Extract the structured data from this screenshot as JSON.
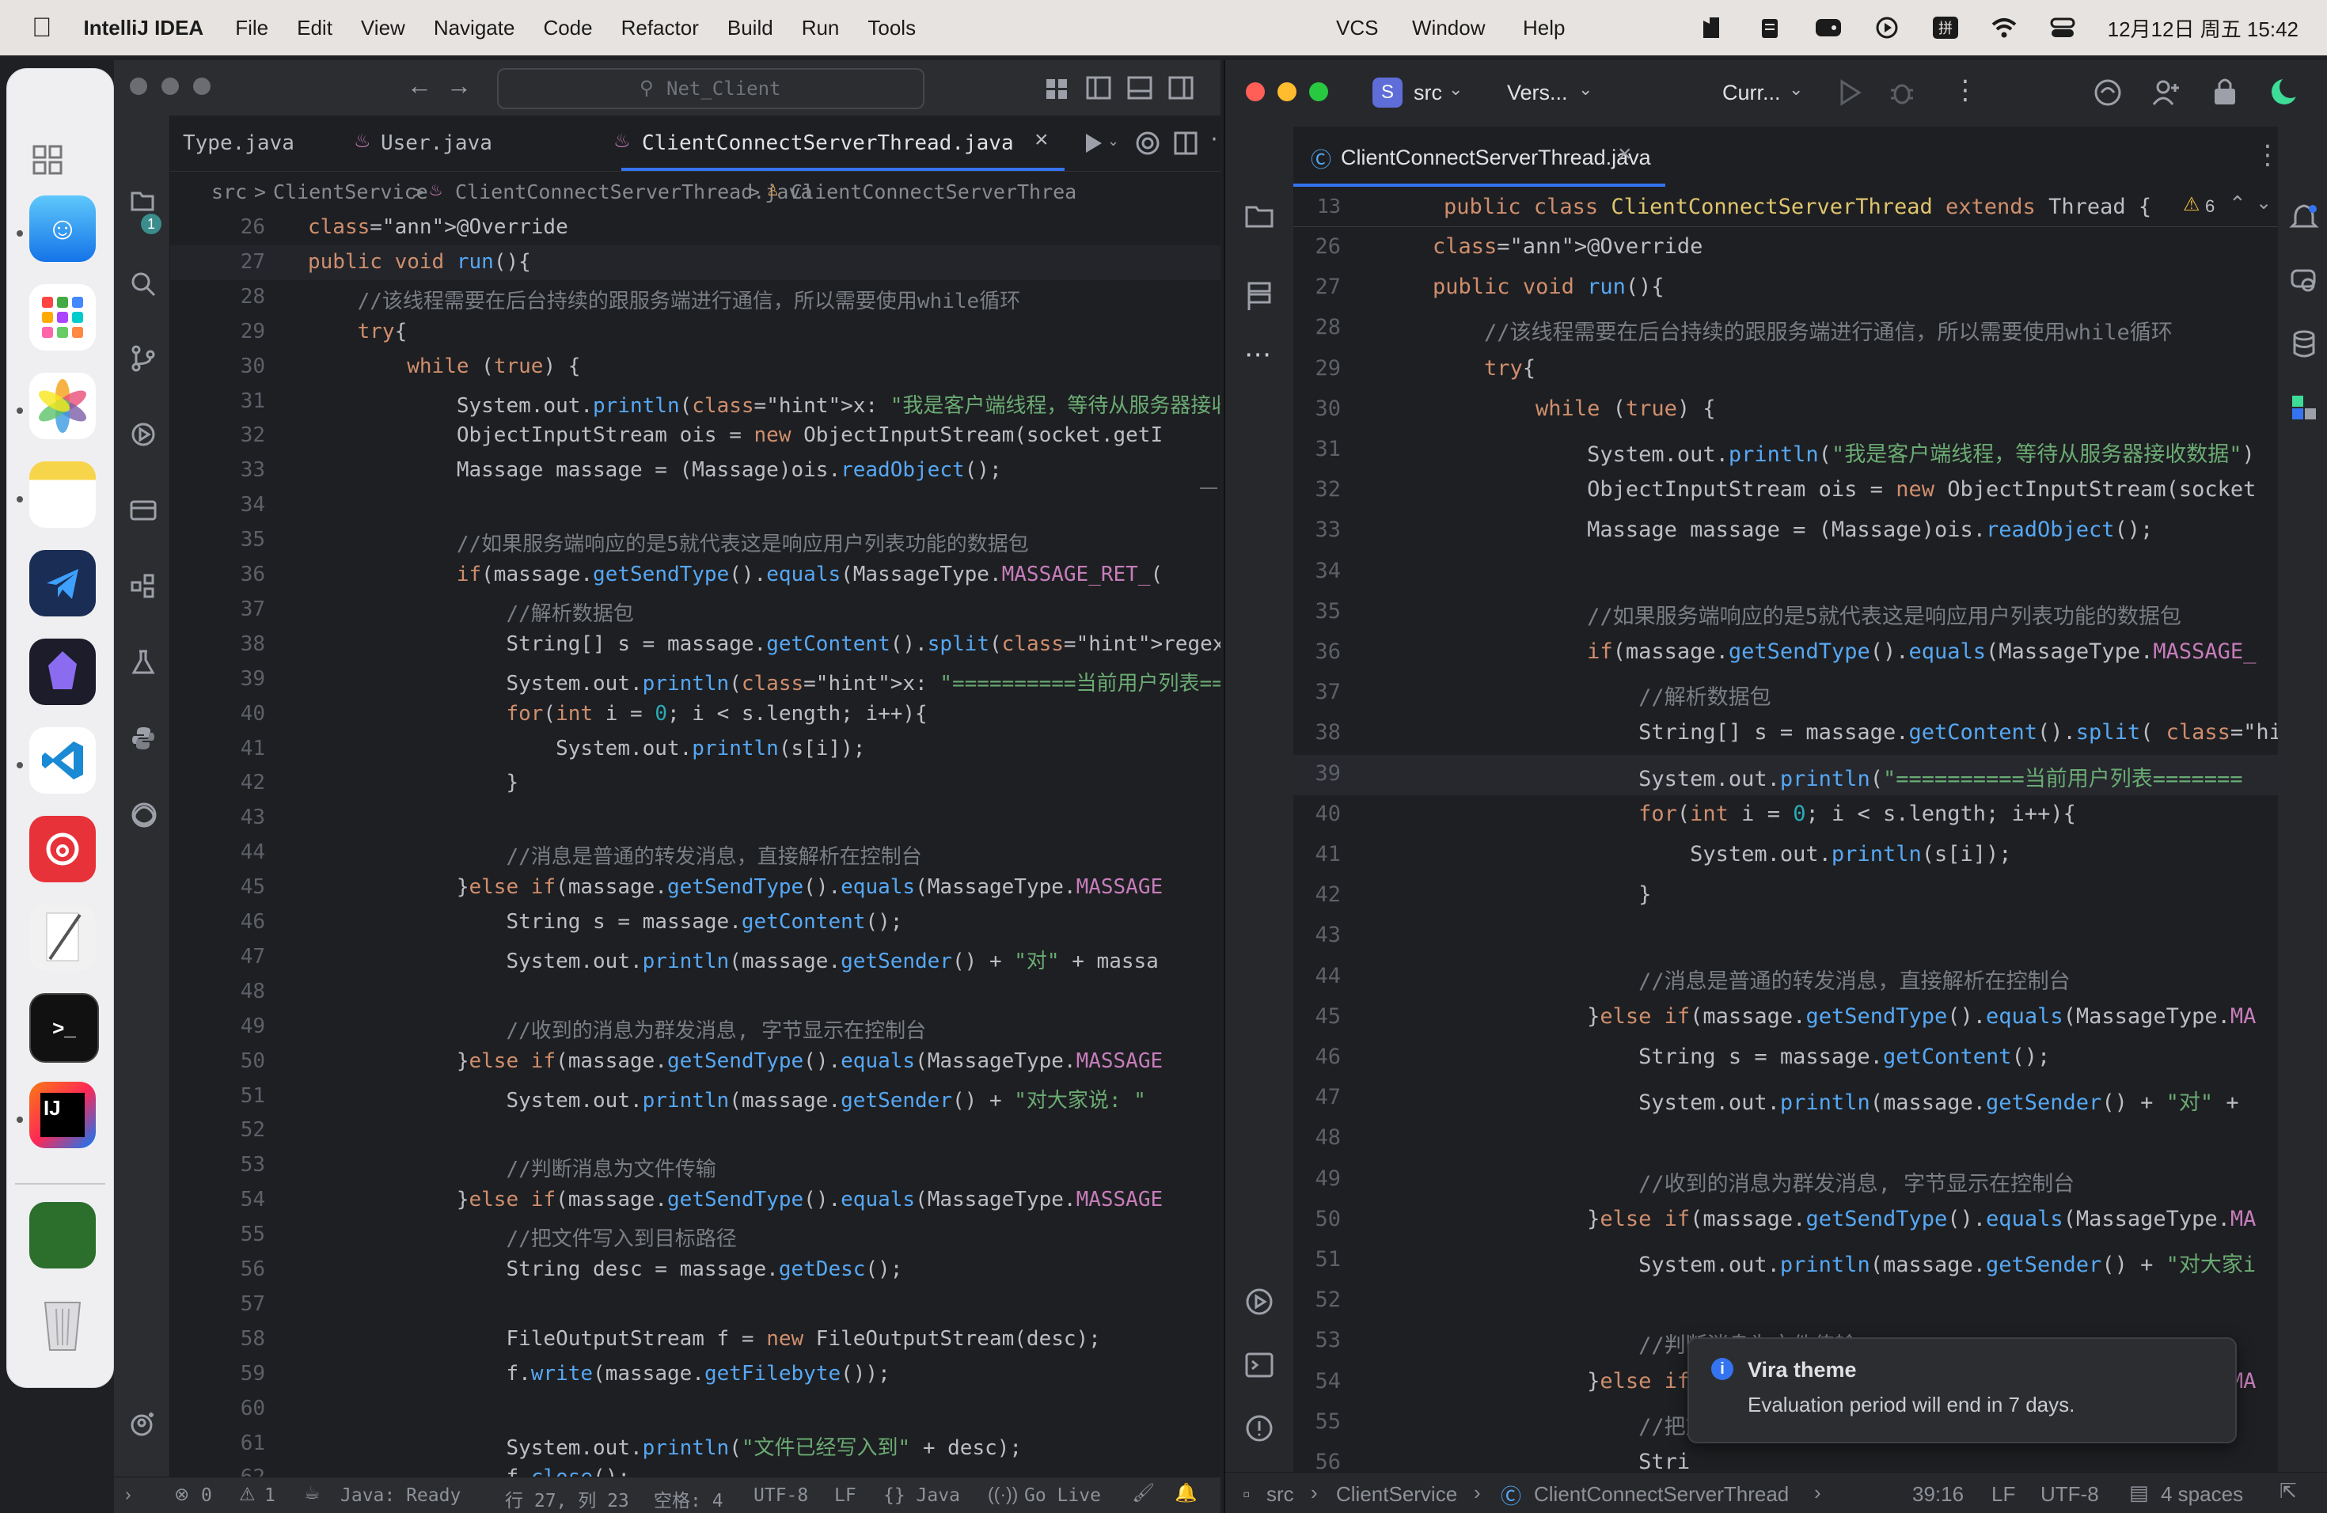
{
  "menubar": {
    "app_name": "IntelliJ IDEA",
    "items": [
      "File",
      "Edit",
      "View",
      "Navigate",
      "Code",
      "Refactor",
      "Build",
      "Run",
      "Tools"
    ],
    "right_items": [
      "VCS",
      "Window",
      "Help"
    ],
    "clock": "12月12日 周五 15:42"
  },
  "left_window": {
    "search_placeholder": "Net_Client",
    "tabs": [
      "Type.java",
      "User.java",
      "ClientConnectServerThread.java"
    ],
    "breadcrumb": [
      "src",
      "ClientService",
      "ClientConnectServerThread.java",
      "ClientConnectServerThrea"
    ],
    "badge": "1",
    "status": {
      "errors": "0",
      "warnings": "1",
      "java_ready": "Java: Ready",
      "position": "行 27, 列 23",
      "spaces": "空格: 4",
      "encoding": "UTF-8",
      "line_sep": "LF",
      "lang": "{} Java",
      "golive": "Go Live"
    }
  },
  "right_window": {
    "project_badge": "S",
    "project_name": "src",
    "vcs": "Vers...",
    "run_config": "Curr...",
    "tab": "ClientConnectServerThread.java",
    "sticky_line_num": "13",
    "sticky_line": "public class ClientConnectServerThread extends Thread {",
    "warning_count": "6",
    "notification": {
      "title": "Vira theme",
      "body": "Evaluation period will end in 7 days."
    },
    "breadcrumb": [
      "src",
      "ClientService",
      "ClientConnectServerThread"
    ],
    "status": {
      "position": "39:16",
      "line_sep": "LF",
      "encoding": "UTF-8",
      "indent": "4 spaces"
    }
  },
  "code_left": [
    {
      "n": "26",
      "t": "@Override"
    },
    {
      "n": "27",
      "t": "public void run(){"
    },
    {
      "n": "28",
      "t": "    //该线程需要在后台持续的跟服务端进行通信，所以需要使用while循环"
    },
    {
      "n": "29",
      "t": "    try{"
    },
    {
      "n": "30",
      "t": "        while (true) {"
    },
    {
      "n": "31",
      "t": "            System.out.println(x: \"我是客户端线程，等待从服务器接收数据\");"
    },
    {
      "n": "32",
      "t": "            ObjectInputStream ois = new ObjectInputStream(socket.getI"
    },
    {
      "n": "33",
      "t": "            Massage massage = (Massage)ois.readObject();"
    },
    {
      "n": "34",
      "t": ""
    },
    {
      "n": "35",
      "t": "            //如果服务端响应的是5就代表这是响应用户列表功能的数据包"
    },
    {
      "n": "36",
      "t": "            if(massage.getSendType().equals(MassageType.MASSAGE_RET_("
    },
    {
      "n": "37",
      "t": "                //解析数据包"
    },
    {
      "n": "38",
      "t": "                String[] s = massage.getContent().split(regex: \":\");"
    },
    {
      "n": "39",
      "t": "                System.out.println(x: \"==========当前用户列表========="
    },
    {
      "n": "40",
      "t": "                for(int i = 0; i < s.length; i++){"
    },
    {
      "n": "41",
      "t": "                    System.out.println(s[i]);"
    },
    {
      "n": "42",
      "t": "                }"
    },
    {
      "n": "43",
      "t": ""
    },
    {
      "n": "44",
      "t": "                //消息是普通的转发消息，直接解析在控制台"
    },
    {
      "n": "45",
      "t": "            }else if(massage.getSendType().equals(MassageType.MASSAGE"
    },
    {
      "n": "46",
      "t": "                String s = massage.getContent();"
    },
    {
      "n": "47",
      "t": "                System.out.println(massage.getSender() + \"对\" + massa"
    },
    {
      "n": "48",
      "t": ""
    },
    {
      "n": "49",
      "t": "                //收到的消息为群发消息, 字节显示在控制台"
    },
    {
      "n": "50",
      "t": "            }else if(massage.getSendType().equals(MassageType.MASSAGE"
    },
    {
      "n": "51",
      "t": "                System.out.println(massage.getSender() + \"对大家说: \" "
    },
    {
      "n": "52",
      "t": ""
    },
    {
      "n": "53",
      "t": "                //判断消息为文件传输"
    },
    {
      "n": "54",
      "t": "            }else if(massage.getSendType().equals(MassageType.MASSAGE"
    },
    {
      "n": "55",
      "t": "                //把文件写入到目标路径"
    },
    {
      "n": "56",
      "t": "                String desc = massage.getDesc();"
    },
    {
      "n": "57",
      "t": ""
    },
    {
      "n": "58",
      "t": "                FileOutputStream f = new FileOutputStream(desc);"
    },
    {
      "n": "59",
      "t": "                f.write(massage.getFilebyte());"
    },
    {
      "n": "60",
      "t": ""
    },
    {
      "n": "61",
      "t": "                System.out.println(\"文件已经写入到\" + desc);"
    },
    {
      "n": "62",
      "t": "                f.close();"
    }
  ],
  "code_right": [
    {
      "n": "26",
      "t": "@Override"
    },
    {
      "n": "27",
      "t": "public void run(){"
    },
    {
      "n": "28",
      "t": "    //该线程需要在后台持续的跟服务端进行通信，所以需要使用while循环"
    },
    {
      "n": "29",
      "t": "    try{"
    },
    {
      "n": "30",
      "t": "        while (true) {"
    },
    {
      "n": "31",
      "t": "            System.out.println(\"我是客户端线程，等待从服务器接收数据\")"
    },
    {
      "n": "32",
      "t": "            ObjectInputStream ois = new ObjectInputStream(socket"
    },
    {
      "n": "33",
      "t": "            Massage massage = (Massage)ois.readObject();"
    },
    {
      "n": "34",
      "t": ""
    },
    {
      "n": "35",
      "t": "            //如果服务端响应的是5就代表这是响应用户列表功能的数据包"
    },
    {
      "n": "36",
      "t": "            if(massage.getSendType().equals(MassageType.MASSAGE_"
    },
    {
      "n": "37",
      "t": "                //解析数据包"
    },
    {
      "n": "38",
      "t": "                String[] s = massage.getContent().split( regex: \":"
    },
    {
      "n": "39",
      "t": "                System.out.println(\"==========当前用户列表======="
    },
    {
      "n": "40",
      "t": "                for(int i = 0; i < s.length; i++){"
    },
    {
      "n": "41",
      "t": "                    System.out.println(s[i]);"
    },
    {
      "n": "42",
      "t": "                }"
    },
    {
      "n": "43",
      "t": ""
    },
    {
      "n": "44",
      "t": "                //消息是普通的转发消息，直接解析在控制台"
    },
    {
      "n": "45",
      "t": "            }else if(massage.getSendType().equals(MassageType.MA"
    },
    {
      "n": "46",
      "t": "                String s = massage.getContent();"
    },
    {
      "n": "47",
      "t": "                System.out.println(massage.getSender() + \"对\" +"
    },
    {
      "n": "48",
      "t": ""
    },
    {
      "n": "49",
      "t": "                //收到的消息为群发消息, 字节显示在控制台"
    },
    {
      "n": "50",
      "t": "            }else if(massage.getSendType().equals(MassageType.MA"
    },
    {
      "n": "51",
      "t": "                System.out.println(massage.getSender() + \"对大家i"
    },
    {
      "n": "52",
      "t": ""
    },
    {
      "n": "53",
      "t": "                //判断消息为文件传输"
    },
    {
      "n": "54",
      "t": "            }else if(massage.getSendType().equals(MassageType.MA"
    },
    {
      "n": "55",
      "t": "                //把文"
    },
    {
      "n": "56",
      "t": "                Stri"
    },
    {
      "n": "57",
      "t": ""
    }
  ],
  "colors": {
    "editor_bg": "#1e1f22",
    "keyword": "#cf8e6d",
    "string": "#6aab73",
    "comment": "#7a7e85",
    "method": "#56a8f5",
    "annotation": "#b3ae60",
    "number": "#2aacb8",
    "accent": "#3574f0"
  }
}
